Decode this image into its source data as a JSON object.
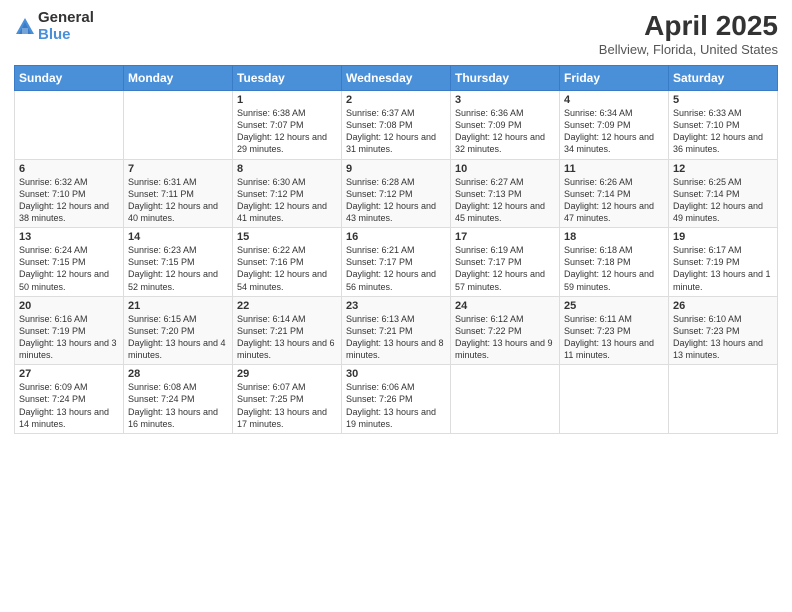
{
  "header": {
    "logo_general": "General",
    "logo_blue": "Blue",
    "title": "April 2025",
    "location": "Bellview, Florida, United States"
  },
  "days_of_week": [
    "Sunday",
    "Monday",
    "Tuesday",
    "Wednesday",
    "Thursday",
    "Friday",
    "Saturday"
  ],
  "weeks": [
    [
      {
        "day": "",
        "sunrise": "",
        "sunset": "",
        "daylight": ""
      },
      {
        "day": "",
        "sunrise": "",
        "sunset": "",
        "daylight": ""
      },
      {
        "day": "1",
        "sunrise": "Sunrise: 6:38 AM",
        "sunset": "Sunset: 7:07 PM",
        "daylight": "Daylight: 12 hours and 29 minutes."
      },
      {
        "day": "2",
        "sunrise": "Sunrise: 6:37 AM",
        "sunset": "Sunset: 7:08 PM",
        "daylight": "Daylight: 12 hours and 31 minutes."
      },
      {
        "day": "3",
        "sunrise": "Sunrise: 6:36 AM",
        "sunset": "Sunset: 7:09 PM",
        "daylight": "Daylight: 12 hours and 32 minutes."
      },
      {
        "day": "4",
        "sunrise": "Sunrise: 6:34 AM",
        "sunset": "Sunset: 7:09 PM",
        "daylight": "Daylight: 12 hours and 34 minutes."
      },
      {
        "day": "5",
        "sunrise": "Sunrise: 6:33 AM",
        "sunset": "Sunset: 7:10 PM",
        "daylight": "Daylight: 12 hours and 36 minutes."
      }
    ],
    [
      {
        "day": "6",
        "sunrise": "Sunrise: 6:32 AM",
        "sunset": "Sunset: 7:10 PM",
        "daylight": "Daylight: 12 hours and 38 minutes."
      },
      {
        "day": "7",
        "sunrise": "Sunrise: 6:31 AM",
        "sunset": "Sunset: 7:11 PM",
        "daylight": "Daylight: 12 hours and 40 minutes."
      },
      {
        "day": "8",
        "sunrise": "Sunrise: 6:30 AM",
        "sunset": "Sunset: 7:12 PM",
        "daylight": "Daylight: 12 hours and 41 minutes."
      },
      {
        "day": "9",
        "sunrise": "Sunrise: 6:28 AM",
        "sunset": "Sunset: 7:12 PM",
        "daylight": "Daylight: 12 hours and 43 minutes."
      },
      {
        "day": "10",
        "sunrise": "Sunrise: 6:27 AM",
        "sunset": "Sunset: 7:13 PM",
        "daylight": "Daylight: 12 hours and 45 minutes."
      },
      {
        "day": "11",
        "sunrise": "Sunrise: 6:26 AM",
        "sunset": "Sunset: 7:14 PM",
        "daylight": "Daylight: 12 hours and 47 minutes."
      },
      {
        "day": "12",
        "sunrise": "Sunrise: 6:25 AM",
        "sunset": "Sunset: 7:14 PM",
        "daylight": "Daylight: 12 hours and 49 minutes."
      }
    ],
    [
      {
        "day": "13",
        "sunrise": "Sunrise: 6:24 AM",
        "sunset": "Sunset: 7:15 PM",
        "daylight": "Daylight: 12 hours and 50 minutes."
      },
      {
        "day": "14",
        "sunrise": "Sunrise: 6:23 AM",
        "sunset": "Sunset: 7:15 PM",
        "daylight": "Daylight: 12 hours and 52 minutes."
      },
      {
        "day": "15",
        "sunrise": "Sunrise: 6:22 AM",
        "sunset": "Sunset: 7:16 PM",
        "daylight": "Daylight: 12 hours and 54 minutes."
      },
      {
        "day": "16",
        "sunrise": "Sunrise: 6:21 AM",
        "sunset": "Sunset: 7:17 PM",
        "daylight": "Daylight: 12 hours and 56 minutes."
      },
      {
        "day": "17",
        "sunrise": "Sunrise: 6:19 AM",
        "sunset": "Sunset: 7:17 PM",
        "daylight": "Daylight: 12 hours and 57 minutes."
      },
      {
        "day": "18",
        "sunrise": "Sunrise: 6:18 AM",
        "sunset": "Sunset: 7:18 PM",
        "daylight": "Daylight: 12 hours and 59 minutes."
      },
      {
        "day": "19",
        "sunrise": "Sunrise: 6:17 AM",
        "sunset": "Sunset: 7:19 PM",
        "daylight": "Daylight: 13 hours and 1 minute."
      }
    ],
    [
      {
        "day": "20",
        "sunrise": "Sunrise: 6:16 AM",
        "sunset": "Sunset: 7:19 PM",
        "daylight": "Daylight: 13 hours and 3 minutes."
      },
      {
        "day": "21",
        "sunrise": "Sunrise: 6:15 AM",
        "sunset": "Sunset: 7:20 PM",
        "daylight": "Daylight: 13 hours and 4 minutes."
      },
      {
        "day": "22",
        "sunrise": "Sunrise: 6:14 AM",
        "sunset": "Sunset: 7:21 PM",
        "daylight": "Daylight: 13 hours and 6 minutes."
      },
      {
        "day": "23",
        "sunrise": "Sunrise: 6:13 AM",
        "sunset": "Sunset: 7:21 PM",
        "daylight": "Daylight: 13 hours and 8 minutes."
      },
      {
        "day": "24",
        "sunrise": "Sunrise: 6:12 AM",
        "sunset": "Sunset: 7:22 PM",
        "daylight": "Daylight: 13 hours and 9 minutes."
      },
      {
        "day": "25",
        "sunrise": "Sunrise: 6:11 AM",
        "sunset": "Sunset: 7:23 PM",
        "daylight": "Daylight: 13 hours and 11 minutes."
      },
      {
        "day": "26",
        "sunrise": "Sunrise: 6:10 AM",
        "sunset": "Sunset: 7:23 PM",
        "daylight": "Daylight: 13 hours and 13 minutes."
      }
    ],
    [
      {
        "day": "27",
        "sunrise": "Sunrise: 6:09 AM",
        "sunset": "Sunset: 7:24 PM",
        "daylight": "Daylight: 13 hours and 14 minutes."
      },
      {
        "day": "28",
        "sunrise": "Sunrise: 6:08 AM",
        "sunset": "Sunset: 7:24 PM",
        "daylight": "Daylight: 13 hours and 16 minutes."
      },
      {
        "day": "29",
        "sunrise": "Sunrise: 6:07 AM",
        "sunset": "Sunset: 7:25 PM",
        "daylight": "Daylight: 13 hours and 17 minutes."
      },
      {
        "day": "30",
        "sunrise": "Sunrise: 6:06 AM",
        "sunset": "Sunset: 7:26 PM",
        "daylight": "Daylight: 13 hours and 19 minutes."
      },
      {
        "day": "",
        "sunrise": "",
        "sunset": "",
        "daylight": ""
      },
      {
        "day": "",
        "sunrise": "",
        "sunset": "",
        "daylight": ""
      },
      {
        "day": "",
        "sunrise": "",
        "sunset": "",
        "daylight": ""
      }
    ]
  ]
}
